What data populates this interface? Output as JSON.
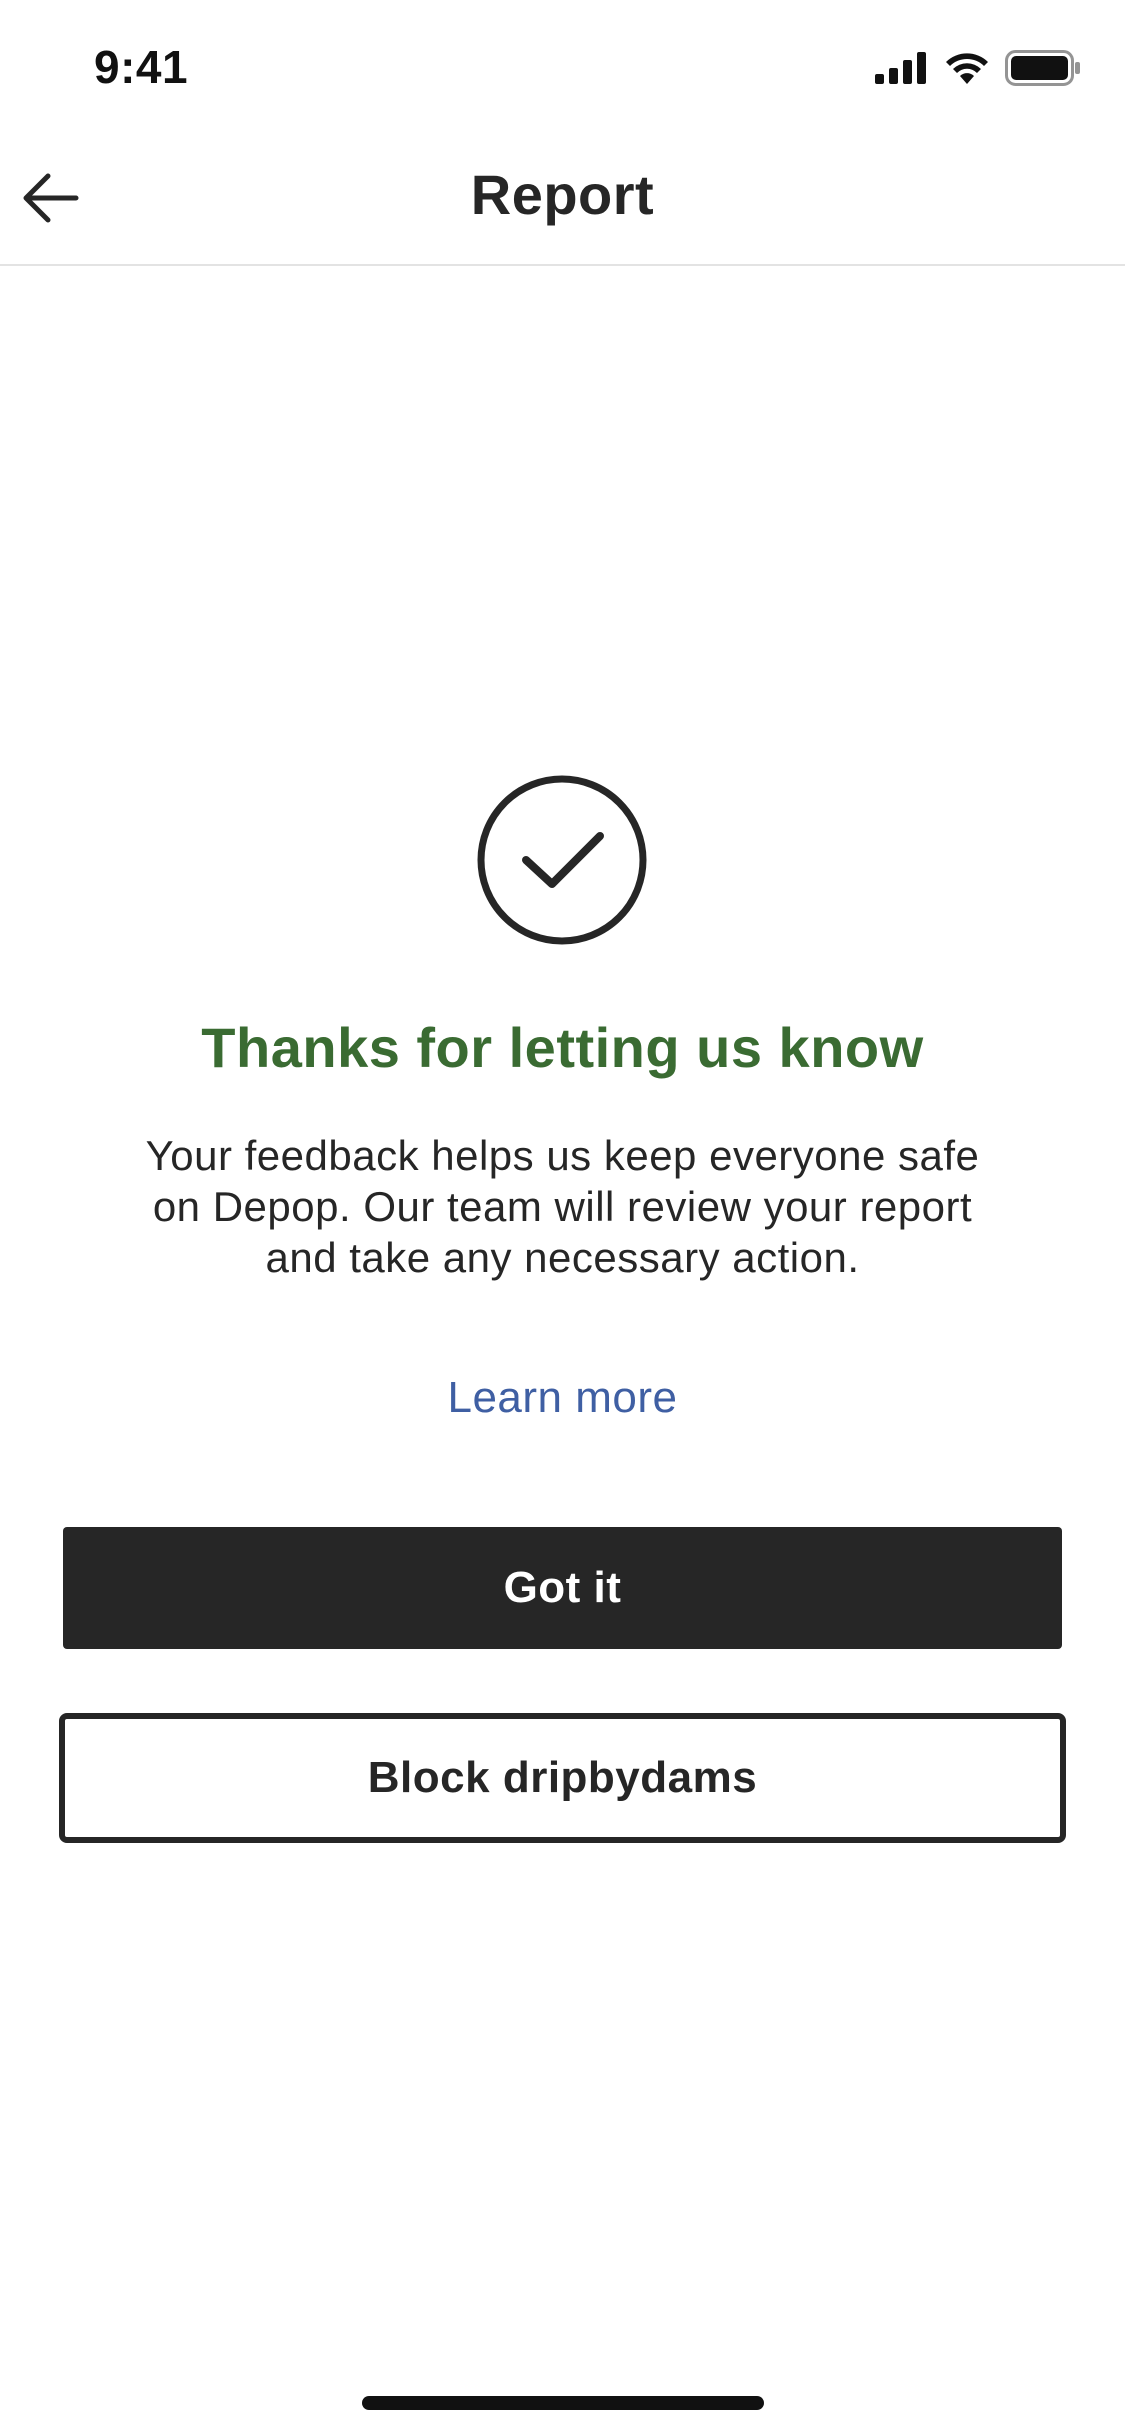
{
  "status_bar": {
    "time": "9:41",
    "icons": [
      "signal-icon",
      "wifi-icon",
      "battery-icon"
    ]
  },
  "nav": {
    "title": "Report",
    "back_icon": "arrow-left-icon"
  },
  "confirmation": {
    "icon": "check-circle-icon",
    "heading": "Thanks for letting us know",
    "body_line1": "Your feedback helps us keep everyone safe",
    "body_line2": "on Depop. Our team will review your report",
    "body_line3": "and take any necessary action.",
    "learn_more_label": "Learn more"
  },
  "actions": {
    "primary_label": "Got it",
    "secondary_label": "Block dripbydams"
  },
  "colors": {
    "heading_green": "#3a6b32",
    "link_blue": "#3f5fa3",
    "button_dark": "#262626"
  }
}
